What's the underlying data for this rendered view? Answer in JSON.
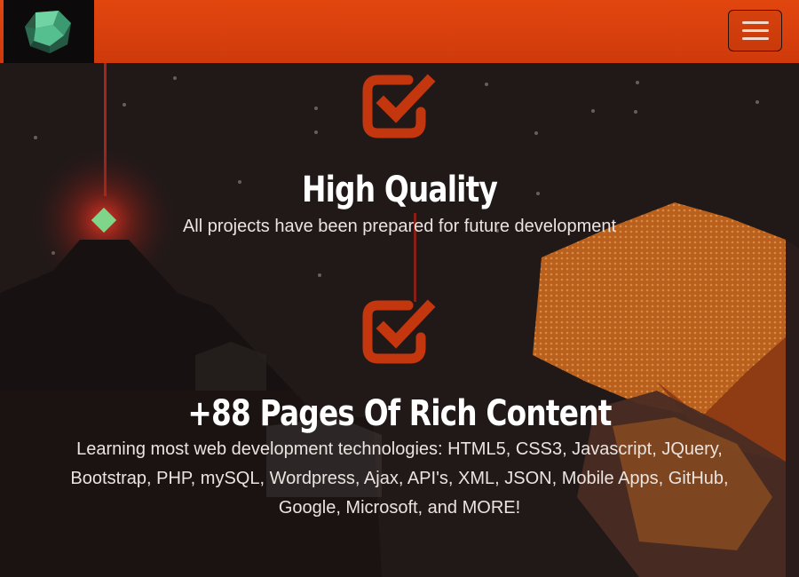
{
  "header": {
    "logo_icon": "gem-logo-icon",
    "menu_icon": "hamburger-menu-icon",
    "accent": "#d9410d"
  },
  "features": [
    {
      "icon": "checkbox-checked-icon",
      "title": "High Quality",
      "lines": [
        "All projects have been prepared for future development"
      ]
    },
    {
      "icon": "checkbox-checked-icon",
      "title": "+88 Pages Of Rich Content",
      "lines": [
        "Learning most web development technologies: HTML5, CSS3, Javascript, JQuery,",
        "Bootstrap, PHP, mySQL, Wordpress, Ajax, API's, XML, JSON, Mobile Apps, GitHub,",
        "Google, Microsoft, and MORE!"
      ]
    }
  ],
  "colors": {
    "background": "#1e1716",
    "icon": "#c4360e",
    "text": "#ffffff"
  }
}
